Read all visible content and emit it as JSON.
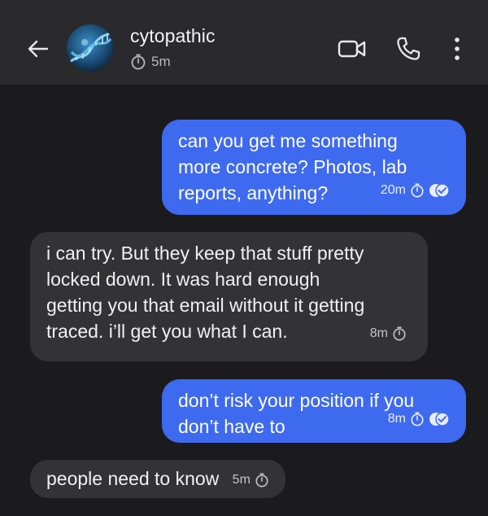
{
  "header": {
    "contact_name": "cytopathic",
    "timer_label": "5m",
    "icons": [
      "back-arrow-icon",
      "video-call-icon",
      "phone-icon",
      "more-vertical-icon"
    ]
  },
  "messages": [
    {
      "direction": "outgoing",
      "lines": [
        "can you get me something",
        "more concrete? Photos, lab",
        "reports, anything?"
      ],
      "time": "20m"
    },
    {
      "direction": "incoming",
      "lines": [
        "i can try. But they keep that stuff pretty",
        "locked down. It was hard enough",
        "getting you that email without it getting",
        "traced. i’ll get you what I can."
      ],
      "time": "8m"
    },
    {
      "direction": "outgoing",
      "lines": [
        "don’t risk your position if you",
        "don’t have to"
      ],
      "time": "8m"
    },
    {
      "direction": "incoming",
      "lines": [
        "people need to know"
      ],
      "time": "5m"
    }
  ],
  "colors": {
    "background": "#1b1b1e",
    "header": "#2a2a2d",
    "outgoing_bubble": "#3e6af0",
    "incoming_bubble": "#333336"
  }
}
